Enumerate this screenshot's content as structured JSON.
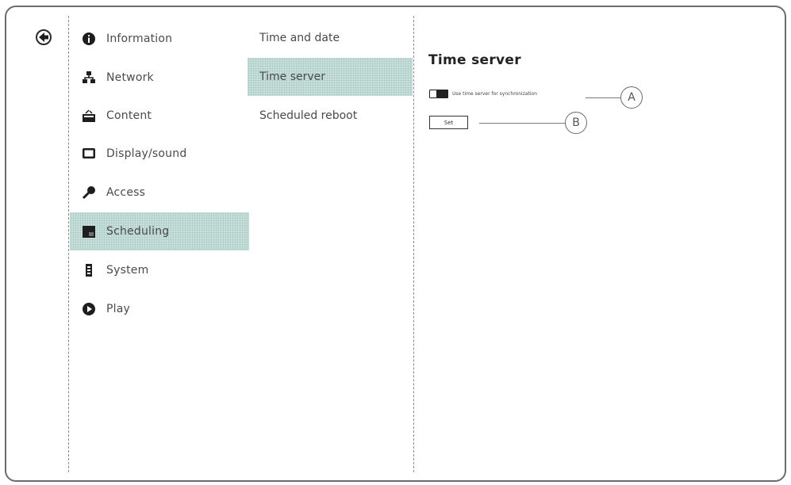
{
  "back": {
    "icon": "arrow-left-icon"
  },
  "menu": [
    {
      "label": "Information",
      "icon": "info-icon"
    },
    {
      "label": "Network",
      "icon": "network-icon"
    },
    {
      "label": "Content",
      "icon": "content-icon"
    },
    {
      "label": "Display/sound",
      "icon": "display-icon"
    },
    {
      "label": "Access",
      "icon": "key-icon"
    },
    {
      "label": "Scheduling",
      "icon": "calendar-icon",
      "selected": true
    },
    {
      "label": "System",
      "icon": "system-icon"
    },
    {
      "label": "Play",
      "icon": "play-icon"
    }
  ],
  "submenu": [
    {
      "label": "Time and date"
    },
    {
      "label": "Time server",
      "selected": true
    },
    {
      "label": "Scheduled reboot"
    }
  ],
  "detail": {
    "title": "Time server",
    "option_label": "Use time server for synchronization",
    "set_button": "Set",
    "callouts": [
      "A",
      "B"
    ]
  },
  "colors": {
    "selected_bg": "#c8dfda",
    "frame": "#6c6c6c"
  }
}
